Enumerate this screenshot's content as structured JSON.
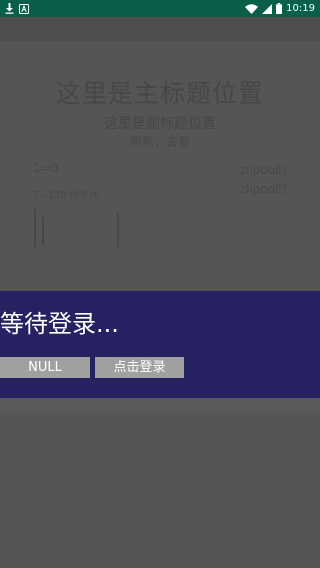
{
  "status_bar": {
    "left_icons": [
      "download-icon",
      "a-icon"
    ],
    "right_icons": [
      "wifi-icon",
      "signal-icon",
      "battery-icon"
    ],
    "time": "10:19",
    "background": "#0a5f4a"
  },
  "background_page": {
    "title": "这里是主标题位置",
    "subtitle": "这里是副标题位置",
    "hint": "刷新，去看",
    "left_line1": "1=0",
    "left_line2": "T=120 命名Hi",
    "right_line1": "zlipoo的",
    "right_line2": "zlipoo的"
  },
  "dialog": {
    "background": "#262262",
    "title": "等待登录...",
    "null_button": "NULL",
    "login_button": "点击登录"
  }
}
